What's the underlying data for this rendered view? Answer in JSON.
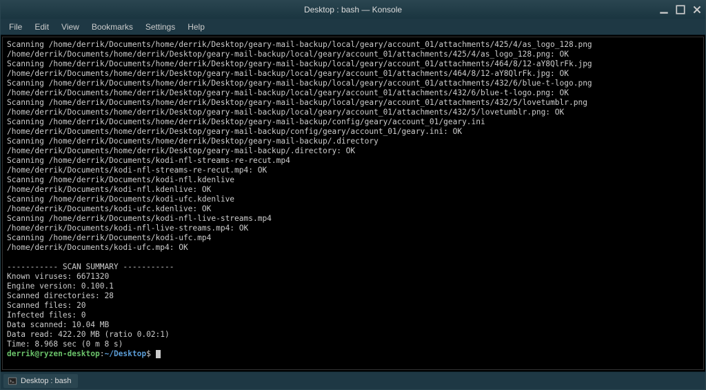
{
  "titlebar": {
    "title": "Desktop : bash — Konsole"
  },
  "menubar": {
    "items": [
      "File",
      "Edit",
      "View",
      "Bookmarks",
      "Settings",
      "Help"
    ]
  },
  "terminal": {
    "lines": [
      "Scanning /home/derrik/Documents/home/derrik/Desktop/geary-mail-backup/local/geary/account_01/attachments/425/4/as_logo_128.png",
      "/home/derrik/Documents/home/derrik/Desktop/geary-mail-backup/local/geary/account_01/attachments/425/4/as_logo_128.png: OK",
      "Scanning /home/derrik/Documents/home/derrik/Desktop/geary-mail-backup/local/geary/account_01/attachments/464/8/12-aY8QlrFk.jpg",
      "/home/derrik/Documents/home/derrik/Desktop/geary-mail-backup/local/geary/account_01/attachments/464/8/12-aY8QlrFk.jpg: OK",
      "Scanning /home/derrik/Documents/home/derrik/Desktop/geary-mail-backup/local/geary/account_01/attachments/432/6/blue-t-logo.png",
      "/home/derrik/Documents/home/derrik/Desktop/geary-mail-backup/local/geary/account_01/attachments/432/6/blue-t-logo.png: OK",
      "Scanning /home/derrik/Documents/home/derrik/Desktop/geary-mail-backup/local/geary/account_01/attachments/432/5/lovetumblr.png",
      "/home/derrik/Documents/home/derrik/Desktop/geary-mail-backup/local/geary/account_01/attachments/432/5/lovetumblr.png: OK",
      "Scanning /home/derrik/Documents/home/derrik/Desktop/geary-mail-backup/config/geary/account_01/geary.ini",
      "/home/derrik/Documents/home/derrik/Desktop/geary-mail-backup/config/geary/account_01/geary.ini: OK",
      "Scanning /home/derrik/Documents/home/derrik/Desktop/geary-mail-backup/.directory",
      "/home/derrik/Documents/home/derrik/Desktop/geary-mail-backup/.directory: OK",
      "Scanning /home/derrik/Documents/kodi-nfl-streams-re-recut.mp4",
      "/home/derrik/Documents/kodi-nfl-streams-re-recut.mp4: OK",
      "Scanning /home/derrik/Documents/kodi-nfl.kdenlive",
      "/home/derrik/Documents/kodi-nfl.kdenlive: OK",
      "Scanning /home/derrik/Documents/kodi-ufc.kdenlive",
      "/home/derrik/Documents/kodi-ufc.kdenlive: OK",
      "Scanning /home/derrik/Documents/kodi-nfl-live-streams.mp4",
      "/home/derrik/Documents/kodi-nfl-live-streams.mp4: OK",
      "Scanning /home/derrik/Documents/kodi-ufc.mp4",
      "/home/derrik/Documents/kodi-ufc.mp4: OK",
      "",
      "----------- SCAN SUMMARY -----------",
      "Known viruses: 6671320",
      "Engine version: 0.100.1",
      "Scanned directories: 28",
      "Scanned files: 20",
      "Infected files: 0",
      "Data scanned: 10.04 MB",
      "Data read: 422.20 MB (ratio 0.02:1)",
      "Time: 8.968 sec (0 m 8 s)"
    ],
    "prompt": {
      "user_host": "derrik@ryzen-desktop",
      "sep1": ":",
      "path": "~/Desktop",
      "sep2": "$ "
    }
  },
  "tab": {
    "label": "Desktop : bash"
  }
}
